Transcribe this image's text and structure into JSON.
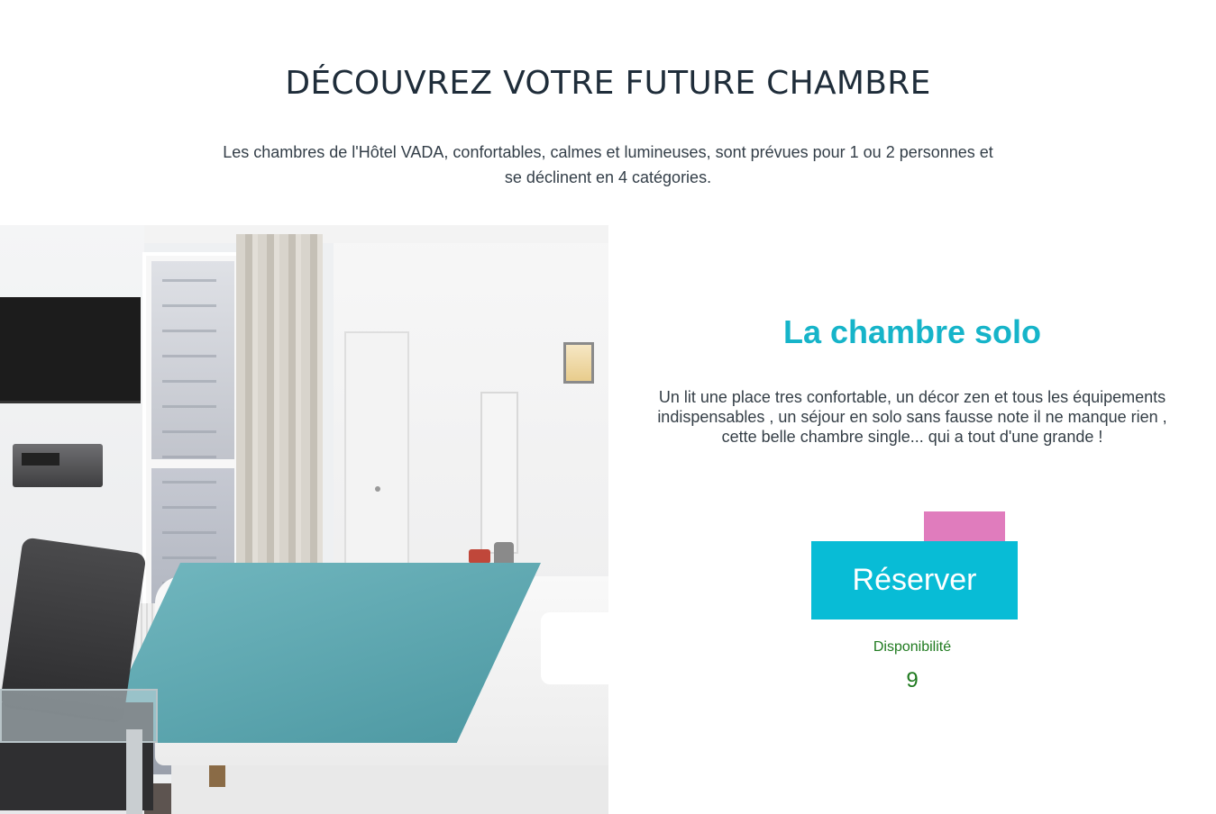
{
  "section": {
    "title": "DÉCOUVREZ VOTRE FUTURE CHAMBRE",
    "intro": "Les chambres de l'Hôtel VADA, confortables, calmes et lumineuses, sont prévues pour 1 ou 2 personnes et se déclinent en 4 catégories."
  },
  "room": {
    "name": "La chambre solo",
    "description": "Un lit une place tres confortable, un décor zen et tous les équipements indispensables , un séjour en solo sans fausse note il ne manque rien , cette belle chambre single... qui a tout d'une grande !",
    "reserve_label": "Réserver",
    "availability_label": "Disponibilité",
    "availability_value": "9"
  },
  "colors": {
    "accent": "#08bcd6",
    "title_accent": "#16b4c9",
    "pink": "#e07cbd",
    "availability": "#1f7a1f"
  }
}
